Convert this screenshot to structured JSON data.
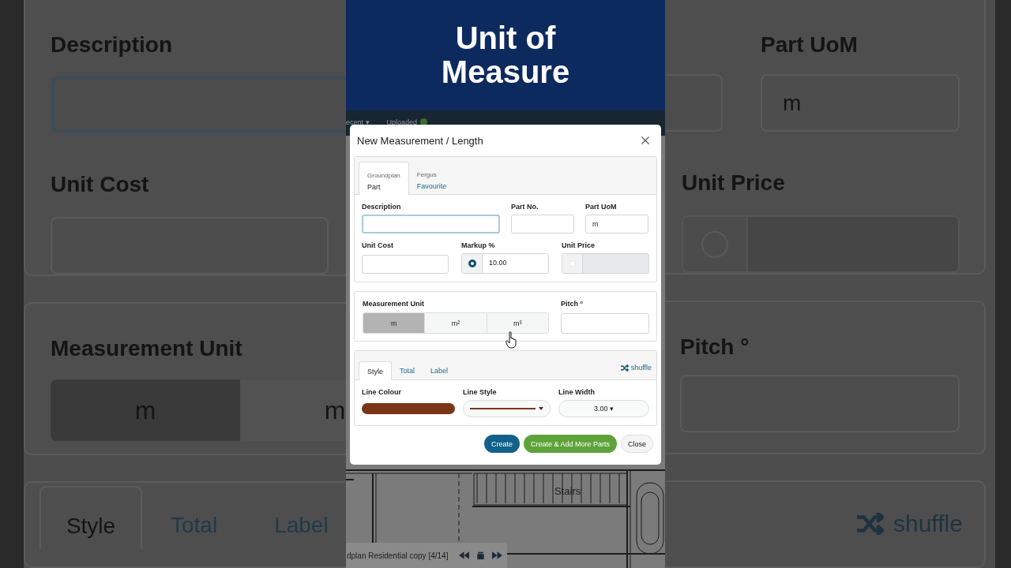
{
  "banner": {
    "title": "Unit of Measure"
  },
  "app_bar": {
    "items": [
      {
        "label": "ecent ▾"
      },
      {
        "label": "Uploaded"
      }
    ]
  },
  "backdrop": {
    "left": {
      "description_label": "Description",
      "unit_cost_label": "Unit Cost",
      "measurement_unit_label": "Measurement Unit",
      "units": [
        {
          "label": "m",
          "selected": true
        },
        {
          "label": "m",
          "selected": false
        }
      ],
      "tabs": [
        {
          "label": "Style",
          "selected": true
        },
        {
          "label": "Total",
          "selected": false
        },
        {
          "label": "Label",
          "selected": false
        }
      ]
    },
    "right": {
      "part_uom_label": "Part UoM",
      "part_uom_value": "m",
      "unit_price_label": "Unit Price",
      "pitch_label": "Pitch °",
      "shuffle": "shuffle"
    }
  },
  "dialog": {
    "title": "New Measurement / Length",
    "source_tabs": [
      {
        "caption": "Groundplan",
        "label": "Part",
        "selected": true
      },
      {
        "caption": "Fergus",
        "label": "Favourite",
        "selected": false
      }
    ],
    "description": {
      "label": "Description",
      "focused": true
    },
    "part_no": {
      "label": "Part No."
    },
    "part_uom": {
      "label": "Part UoM",
      "value": "m"
    },
    "unit_cost": {
      "label": "Unit Cost"
    },
    "markup": {
      "label": "Markup %",
      "value": "10.00",
      "selected": true
    },
    "unit_price": {
      "label": "Unit Price",
      "selected": false
    },
    "measurement_unit": {
      "label": "Measurement Unit",
      "options": [
        {
          "label": "m",
          "selected": true
        },
        {
          "label": "m²",
          "selected": false
        },
        {
          "label": "m³",
          "selected": false
        }
      ]
    },
    "pitch": {
      "label": "Pitch °"
    },
    "style_tabs": [
      {
        "label": "Style",
        "selected": true
      },
      {
        "label": "Total",
        "selected": false
      },
      {
        "label": "Label",
        "selected": false
      }
    ],
    "shuffle": "shuffle",
    "line_colour": {
      "label": "Line Colour",
      "color": "#7a3517"
    },
    "line_style": {
      "label": "Line Style",
      "color": "#7a3517"
    },
    "line_width": {
      "label": "Line Width",
      "value": "3.00 ▾"
    },
    "buttons": [
      {
        "label": "Create",
        "kind": "primary"
      },
      {
        "label": "Create & Add More Parts",
        "kind": "success"
      },
      {
        "label": "Close",
        "kind": "default"
      }
    ]
  },
  "floorplan": {
    "room_label": "Stairs"
  },
  "bottom_bar": {
    "file": "dplan Residential copy [4/14]"
  }
}
